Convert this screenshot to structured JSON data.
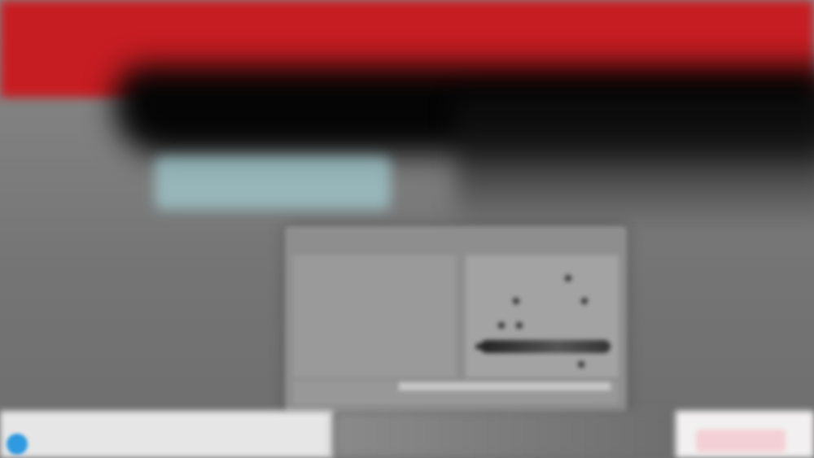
{
  "colors": {
    "header_red": "#c61d22",
    "dark_band": "#050505",
    "headline_highlight": "#afe8ee",
    "accent_blue": "#2f9ae0",
    "button_pink": "#f3d0d5"
  },
  "headline": {
    "line1": "",
    "line2": ""
  },
  "map_panel": {
    "left_title": "",
    "left_subtitle": "",
    "right_title": ""
  },
  "icons": {
    "control": "blue-circle",
    "map_markers": "dot"
  }
}
